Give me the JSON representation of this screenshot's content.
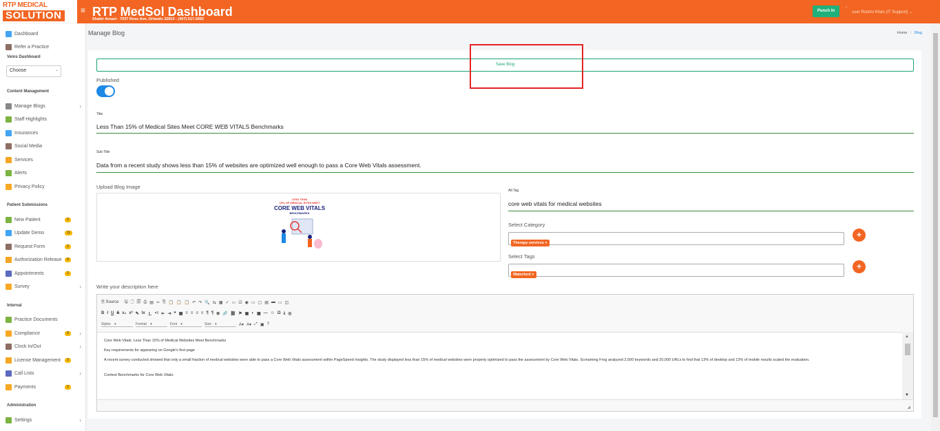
{
  "header": {
    "logo_top": "RTP MEDICAL",
    "logo_bottom": "SOLUTION",
    "title": "RTP MedSol Dashboard",
    "subtitle": "Shakir Ansari - 7037 Rose Ave, Orlando 32810 - (407) 617-2692",
    "punch_label": "Punch In",
    "user_alt": "user",
    "user_name": "Roshni Khan (IT Support)",
    "accent": "#f26522"
  },
  "sidebar": {
    "items_top": [
      {
        "label": "Dashboard",
        "icon": "dashboard-icon"
      },
      {
        "label": "Refer a Practice",
        "icon": "refer-icon"
      }
    ],
    "veins_section": "Veins Dashboard",
    "veins_select": "Choose",
    "content_section": "Content Management",
    "content_items": [
      {
        "label": "Manage Blogs",
        "icon": "blog-icon",
        "chevron": true
      },
      {
        "label": "Staff Highlights",
        "icon": "staff-icon"
      },
      {
        "label": "Insurances",
        "icon": "insurance-icon"
      },
      {
        "label": "Social Media",
        "icon": "social-icon"
      },
      {
        "label": "Services",
        "icon": "services-icon"
      },
      {
        "label": "Alerts",
        "icon": "alert-icon"
      },
      {
        "label": "Privacy Policy",
        "icon": "privacy-icon"
      }
    ],
    "patient_section": "Patient Submissions",
    "patient_items": [
      {
        "label": "New Patient",
        "icon": "new-patient-icon",
        "badge": "2"
      },
      {
        "label": "Update Demo",
        "icon": "update-demo-icon",
        "badge": "11"
      },
      {
        "label": "Request Form",
        "icon": "request-icon",
        "badge": "2"
      },
      {
        "label": "Authorization Release",
        "icon": "authorization-icon",
        "badge": "9"
      },
      {
        "label": "Appointments",
        "icon": "appointments-icon",
        "badge": "2"
      },
      {
        "label": "Survey",
        "icon": "survey-icon",
        "chevron": true
      }
    ],
    "internal_section": "Internal",
    "internal_items": [
      {
        "label": "Practice Documents",
        "icon": "documents-icon"
      },
      {
        "label": "Compliance",
        "icon": "compliance-icon",
        "badge": "9",
        "chevron": true
      },
      {
        "label": "Clock In/Out",
        "icon": "clock-icon",
        "chevron": true
      },
      {
        "label": "License Management",
        "icon": "license-icon",
        "badge": "3"
      },
      {
        "label": "Call Lists",
        "icon": "call-icon",
        "chevron": true
      },
      {
        "label": "Payments",
        "icon": "payments-icon",
        "badge": "2"
      }
    ],
    "admin_section": "Administration",
    "admin_items": [
      {
        "label": "Settings",
        "icon": "settings-icon",
        "chevron": true
      }
    ]
  },
  "page": {
    "title": "Manage Blog",
    "breadcrumb_home": "Home",
    "breadcrumb_sep": "/",
    "breadcrumb_current": "Blog"
  },
  "form": {
    "save_label": "Save Blog",
    "published_label": "Published",
    "published": true,
    "title_label": "Title",
    "title_value": "Less Than 15% of Medical Sites Meet CORE WEB VITALS Benchmarks",
    "subtitle_label": "Sub Title",
    "subtitle_value": "Data from a recent study shows less than 15% of websites are optimized well enough to pass a Core Web Vitals assessment.",
    "upload_label": "Upload Blog Image",
    "image_text_1": "LESS THAN",
    "image_text_2": "15% OF MEDICAL SITES MEET",
    "image_text_3": "CORE WEB VITALS",
    "image_text_4": "BENCHMARKS",
    "alt_label": "Alt Tag",
    "alt_value": "core web vitals for medical websites",
    "category_label": "Select Category",
    "category_chip": "Therapy services ×",
    "tags_label": "Select Tags",
    "tags_chip": "Waterford ×",
    "plus": "+",
    "description_label": "Write your description here"
  },
  "editor": {
    "source_label": "Source",
    "styles": "Styles",
    "format": "Format",
    "font": "Font",
    "size": "Size",
    "paragraphs": [
      "Core Web Vitals: Less Than 15% of Medical Websites Meet Benchmarks",
      "Key requirements for appearing on Google's first page",
      "A recent survey conducted showed that only a small fraction of medical websites were able to pass a Core Web Vitals assessment within PageSpeed Insights. The study displayed less than 15% of medical websites were properly optimized to pass the assessment by Core Web Vitals. Screaming Frog analyzed 2,500 keywords and 20,000 URLs to find that 13% of desktop and 12% of mobile results scaled the evaluation.",
      "Context Benchmarks for Core Web Vitals:"
    ]
  }
}
